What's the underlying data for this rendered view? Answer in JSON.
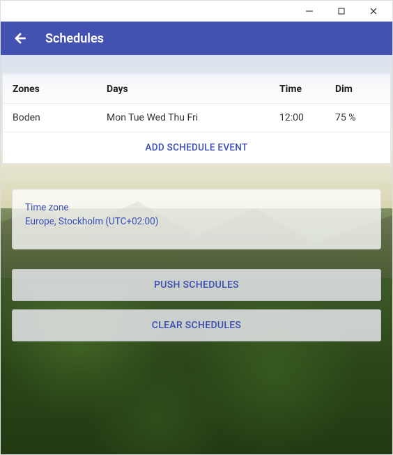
{
  "header": {
    "title": "Schedules"
  },
  "table": {
    "headers": {
      "zones": "Zones",
      "days": "Days",
      "time": "Time",
      "dim": "Dim"
    },
    "rows": [
      {
        "zones": "Boden",
        "days": "Mon Tue Wed Thu Fri",
        "time": "12:00",
        "dim": "75 %"
      }
    ],
    "add_label": "ADD SCHEDULE EVENT"
  },
  "timezone": {
    "label": "Time zone",
    "value": "Europe, Stockholm (UTC+02:00)"
  },
  "buttons": {
    "push": "PUSH SCHEDULES",
    "clear": "CLEAR SCHEDULES"
  }
}
